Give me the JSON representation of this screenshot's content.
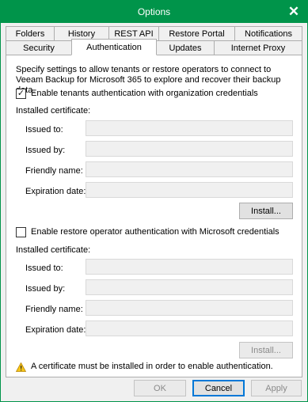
{
  "window": {
    "title": "Options"
  },
  "tabs_row1": [
    "Folders",
    "History",
    "REST API",
    "Restore Portal",
    "Notifications"
  ],
  "tabs_row2": [
    "Security",
    "Authentication",
    "Updates",
    "Internet Proxy"
  ],
  "active_tab": "Authentication",
  "description": "Specify settings to allow tenants or restore operators to connect to Veeam Backup for Microsoft 365 to explore and recover their backup data.",
  "tenants": {
    "checkbox_label": "Enable tenants authentication with organization credentials",
    "checked": true,
    "cert_heading": "Installed certificate:",
    "fields": [
      {
        "label": "Issued to:",
        "value": ""
      },
      {
        "label": "Issued by:",
        "value": ""
      },
      {
        "label": "Friendly name:",
        "value": ""
      },
      {
        "label": "Expiration date:",
        "value": ""
      }
    ],
    "install_label": "Install..."
  },
  "operators": {
    "checkbox_label": "Enable restore operator authentication with Microsoft credentials",
    "checked": false,
    "cert_heading": "Installed certificate:",
    "fields": [
      {
        "label": "Issued to:",
        "value": ""
      },
      {
        "label": "Issued by:",
        "value": ""
      },
      {
        "label": "Friendly name:",
        "value": ""
      },
      {
        "label": "Expiration date:",
        "value": ""
      }
    ],
    "install_label": "Install..."
  },
  "warning": "A certificate must be installed in order to enable authentication.",
  "footer": {
    "ok_label": "OK",
    "cancel_label": "Cancel",
    "apply_label": "Apply"
  },
  "colors": {
    "titlebar": "#00944a",
    "warning_icon": "#f5c518"
  }
}
